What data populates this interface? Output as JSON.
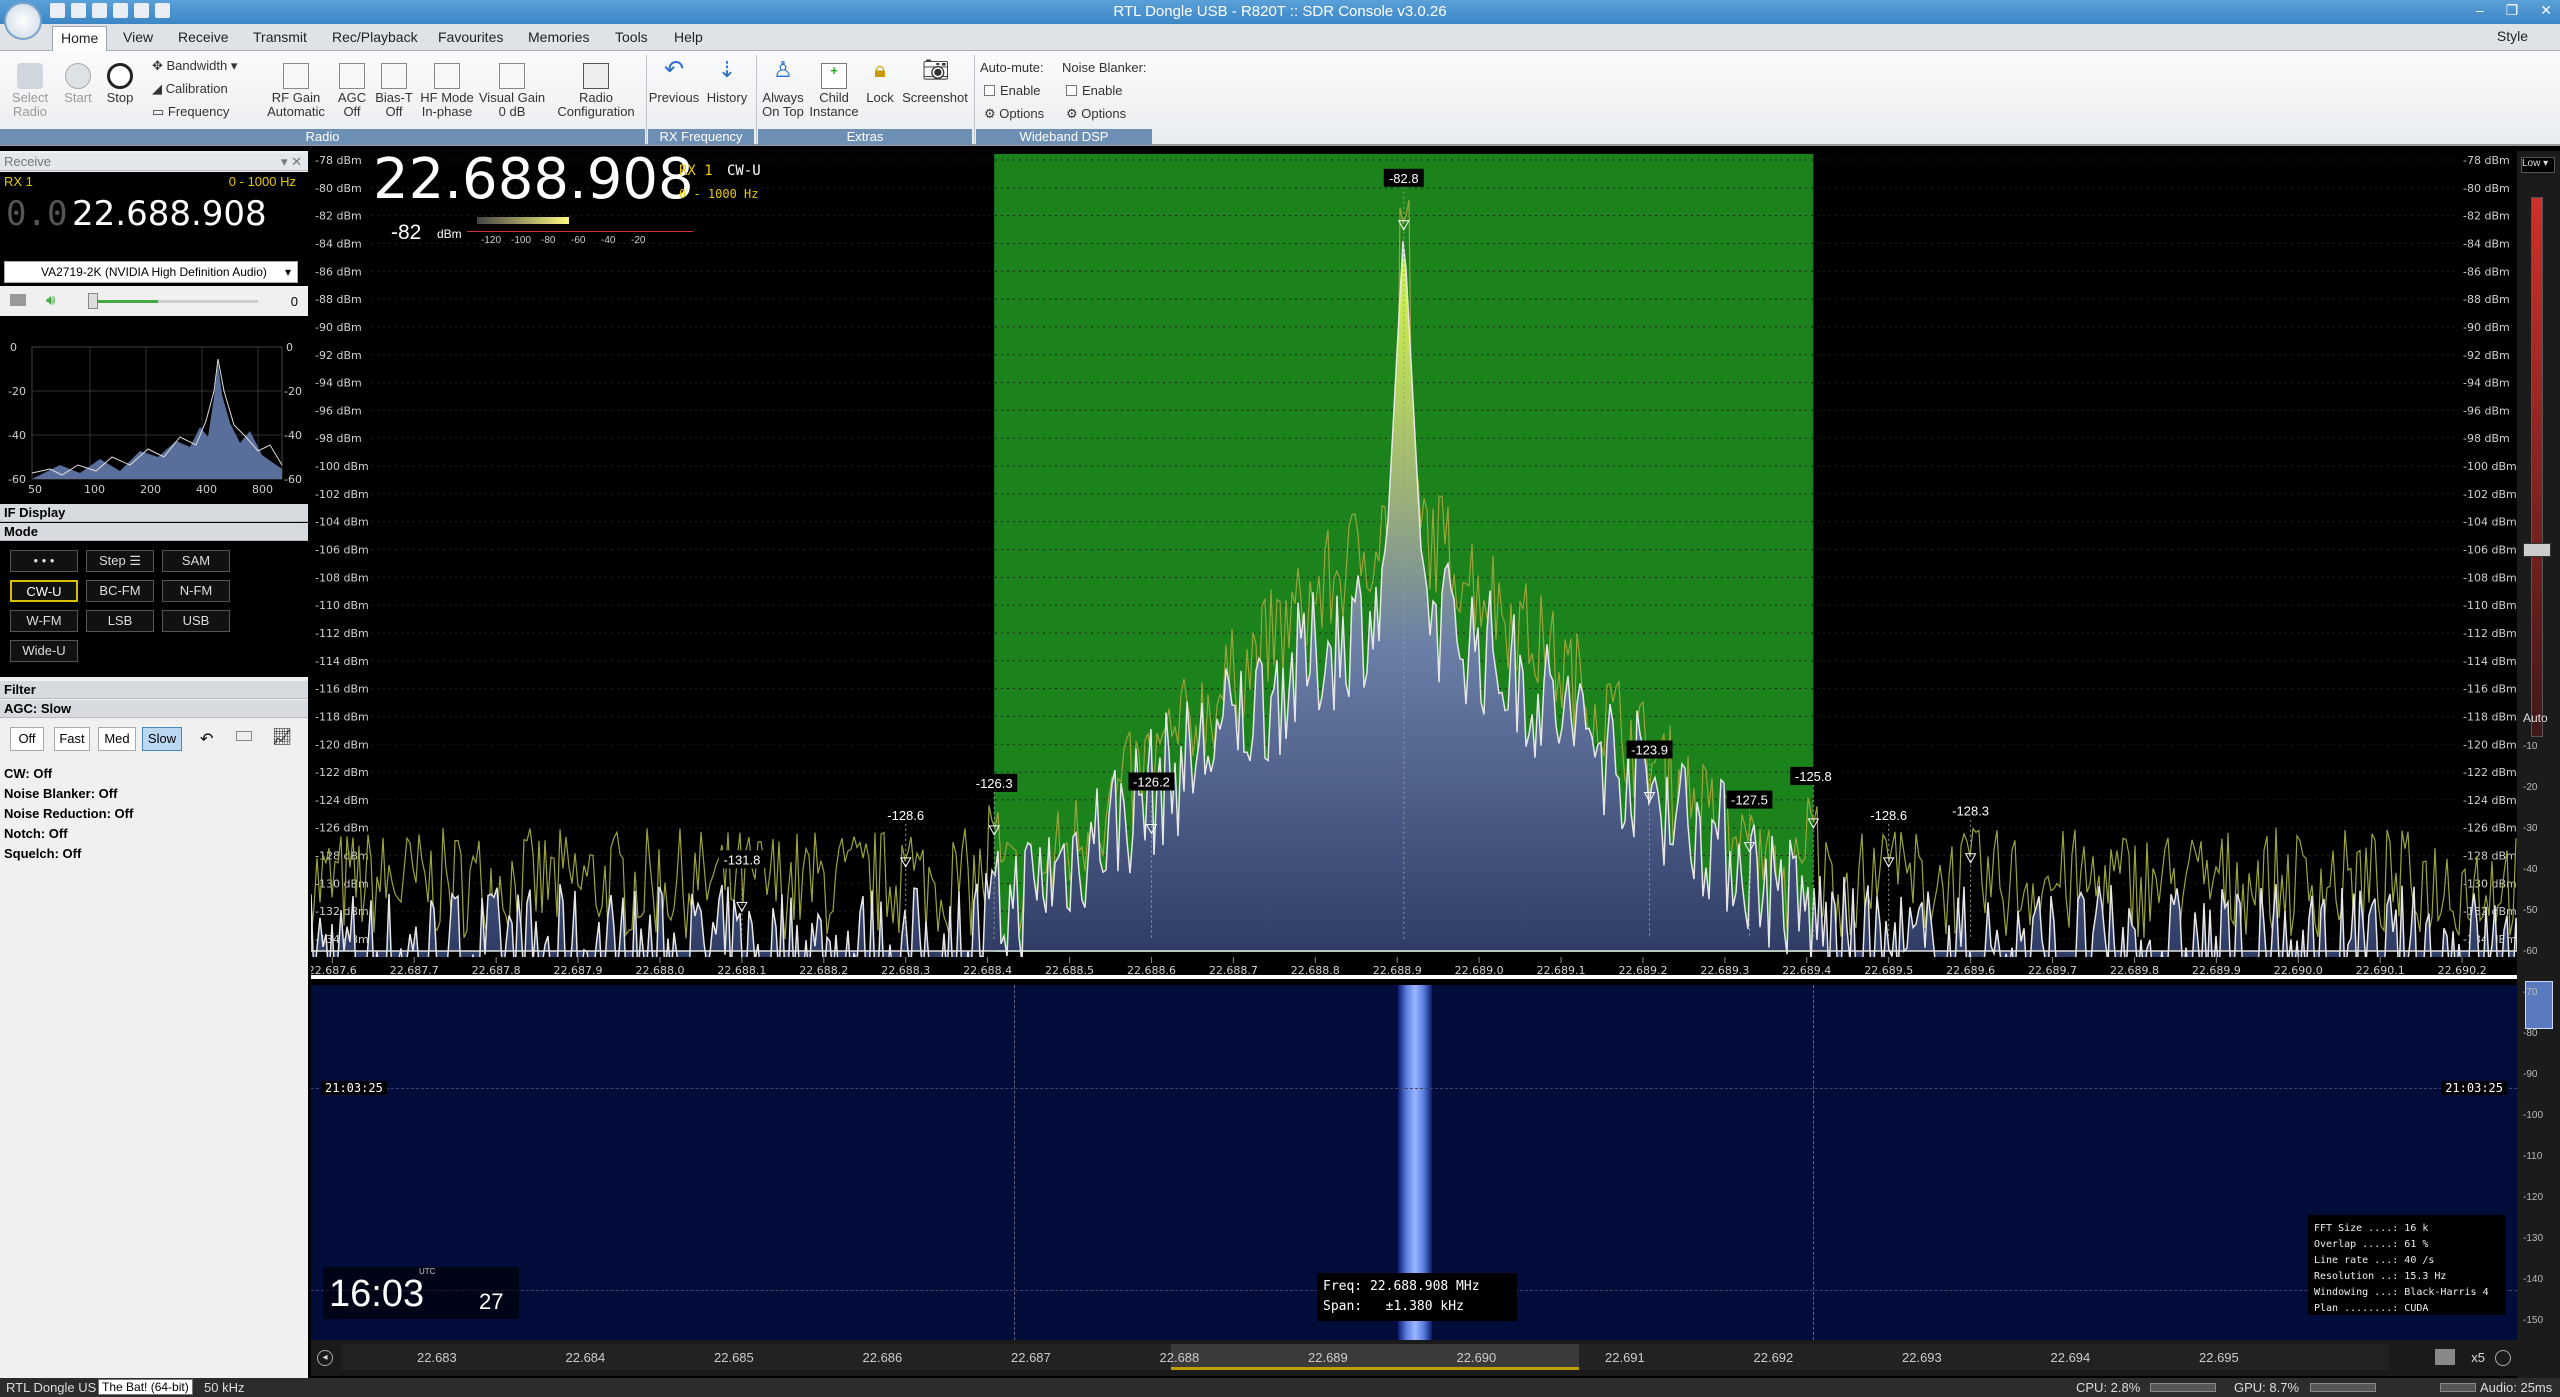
{
  "window": {
    "title": "RTL Dongle USB - R820T :: SDR Console v3.0.26",
    "controls": [
      "–",
      "❐",
      "✕"
    ]
  },
  "menu": {
    "tabs": [
      "Home",
      "View",
      "Receive",
      "Transmit",
      "Rec/Playback",
      "Favourites",
      "Memories",
      "Tools",
      "Help"
    ],
    "selected": "Home",
    "style_label": "Style"
  },
  "ribbon": {
    "radio": {
      "select_radio": "Select Radio",
      "start": "Start",
      "stop": "Stop",
      "bandwidth": "Bandwidth",
      "calibration": "Calibration",
      "frequency": "Frequency",
      "rf_gain": "RF Gain Automatic",
      "agc": "AGC Off",
      "bias_t": "Bias-T Off",
      "hf_mode": "HF Mode In-phase",
      "visual_gain": "Visual Gain 0 dB",
      "radio_config": "Radio Configuration",
      "group": "Radio"
    },
    "rxfreq": {
      "previous": "Previous",
      "history": "History",
      "group": "RX Frequency"
    },
    "extras": {
      "always_on_top": "Always On Top",
      "child_instance": "Child Instance",
      "lock": "Lock",
      "screenshot": "Screenshot",
      "group": "Extras"
    },
    "wideband": {
      "auto_mute": "Auto-mute:",
      "enable": "Enable",
      "options": "Options",
      "noise_blanker": "Noise Blanker:",
      "group": "Wideband DSP"
    }
  },
  "receive": {
    "title": "Receive",
    "rx": "RX 1",
    "range": "0 - 1000 Hz",
    "freq_dim": "0.0",
    "freq": "22.688.908",
    "audio_device": "VA2719-2K (NVIDIA High Definition Audio)",
    "volume": "0"
  },
  "if_display": {
    "title": "IF Display",
    "y_ticks": [
      "0",
      "-20",
      "-40",
      "-60"
    ],
    "x_ticks": [
      "50",
      "100",
      "200",
      "400",
      "800"
    ]
  },
  "mode": {
    "title": "Mode",
    "buttons": [
      "• • •",
      "Step ☰",
      "SAM",
      "CW-U",
      "BC-FM",
      "N-FM",
      "W-FM",
      "LSB",
      "USB",
      "Wide-U"
    ],
    "selected": "CW-U"
  },
  "filter": {
    "title": "Filter",
    "agc_label": "AGC: Slow",
    "agc_buttons": [
      "Off",
      "Fast",
      "Med",
      "Slow"
    ],
    "agc_selected": "Slow"
  },
  "options": [
    "CW: Off",
    "Noise Blanker: Off",
    "Noise Reduction: Off",
    "Notch: Off",
    "Squelch: Off"
  ],
  "spectrum": {
    "freq_display": "22.688.908",
    "rx": "RX 1",
    "mode": "CW-U",
    "range": "0 - 1000 Hz",
    "level": "-82",
    "level_unit": "dBm",
    "meter_ticks": [
      "-120",
      "-100",
      "-80",
      "-60",
      "-40",
      "-20"
    ],
    "db_ticks": [
      "-78 dBm",
      "-80 dBm",
      "-82 dBm",
      "-84 dBm",
      "-86 dBm",
      "-88 dBm",
      "-90 dBm",
      "-92 dBm",
      "-94 dBm",
      "-96 dBm",
      "-98 dBm",
      "-100 dBm",
      "-102 dBm",
      "-104 dBm",
      "-106 dBm",
      "-108 dBm",
      "-110 dBm",
      "-112 dBm",
      "-114 dBm",
      "-116 dBm",
      "-118 dBm",
      "-120 dBm",
      "-122 dBm",
      "-124 dBm",
      "-126 dBm",
      "-128 dBm",
      "-130 dBm",
      "-132 dBm",
      "-134 dBm"
    ],
    "freq_ticks": [
      "22.687.6",
      "22.687.7",
      "22.687.8",
      "22.687.9",
      "22.688.0",
      "22.688.1",
      "22.688.2",
      "22.688.3",
      "22.688.4",
      "22.688.5",
      "22.688.6",
      "22.688.7",
      "22.688.8",
      "22.688.9",
      "22.689.0",
      "22.689.1",
      "22.689.2",
      "22.689.3",
      "22.689.4",
      "22.689.5",
      "22.689.6",
      "22.689.7",
      "22.689.8",
      "22.689.9",
      "22.690.0",
      "22.690.1",
      "22.690.2"
    ],
    "peaks": [
      {
        "f": 22688.1,
        "v": -131.8
      },
      {
        "f": 22688.3,
        "v": -128.6
      },
      {
        "f": 22688.408,
        "v": -126.3
      },
      {
        "f": 22688.6,
        "v": -126.2
      },
      {
        "f": 22688.908,
        "v": -82.8
      },
      {
        "f": 22689.208,
        "v": -123.9
      },
      {
        "f": 22689.33,
        "v": -127.5
      },
      {
        "f": 22689.408,
        "v": -125.8
      },
      {
        "f": 22689.5,
        "v": -128.6
      },
      {
        "f": 22689.6,
        "v": -128.3
      }
    ],
    "peak_labels": [
      "-131.8",
      "-128.6",
      "-126.3",
      "-126.2",
      "-82.8",
      "-123.9",
      "-127.5",
      "-125.8",
      "-128.6",
      "-128.3"
    ],
    "passband": [
      22688.408,
      22689.408
    ]
  },
  "waterfall": {
    "time_left": "21:03:25",
    "time_right": "21:03:25",
    "clock_hm": "16:03",
    "clock_s": "27",
    "clock_utc": "UTC",
    "freq_label": "Freq:",
    "freq_value": "22.688.908 MHz",
    "span_label": "Span:",
    "span_value": "±1.380 kHz",
    "fft": [
      "FFT Size ....: 16 k",
      "Overlap .....: 61 %",
      "Line rate ...: 40 /s",
      "Resolution ..: 15.3 Hz",
      "Windowing ...: Black-Harris 4",
      "Plan ........: CUDA"
    ]
  },
  "freqbar": {
    "ticks": [
      "22.683",
      "22.684",
      "22.685",
      "22.686",
      "22.687",
      "22.688",
      "22.689",
      "22.690",
      "22.691",
      "22.692",
      "22.693",
      "22.694",
      "22.695"
    ],
    "zoom": "x5"
  },
  "right": {
    "top": "Low",
    "auto": "Auto",
    "scale": [
      "-10",
      "-20",
      "-30",
      "-40",
      "-50",
      "-60",
      "-70",
      "-80",
      "-90",
      "-100",
      "-110",
      "-120",
      "-130",
      "-140",
      "-150"
    ]
  },
  "status": {
    "left": "RTL Dongle US",
    "tooltip": "The Bat! (64-bit)",
    "bw": "50 kHz",
    "cpu": "CPU: 2.8%",
    "gpu": "GPU: 8.7%",
    "audio": "Audio: 25ms"
  }
}
